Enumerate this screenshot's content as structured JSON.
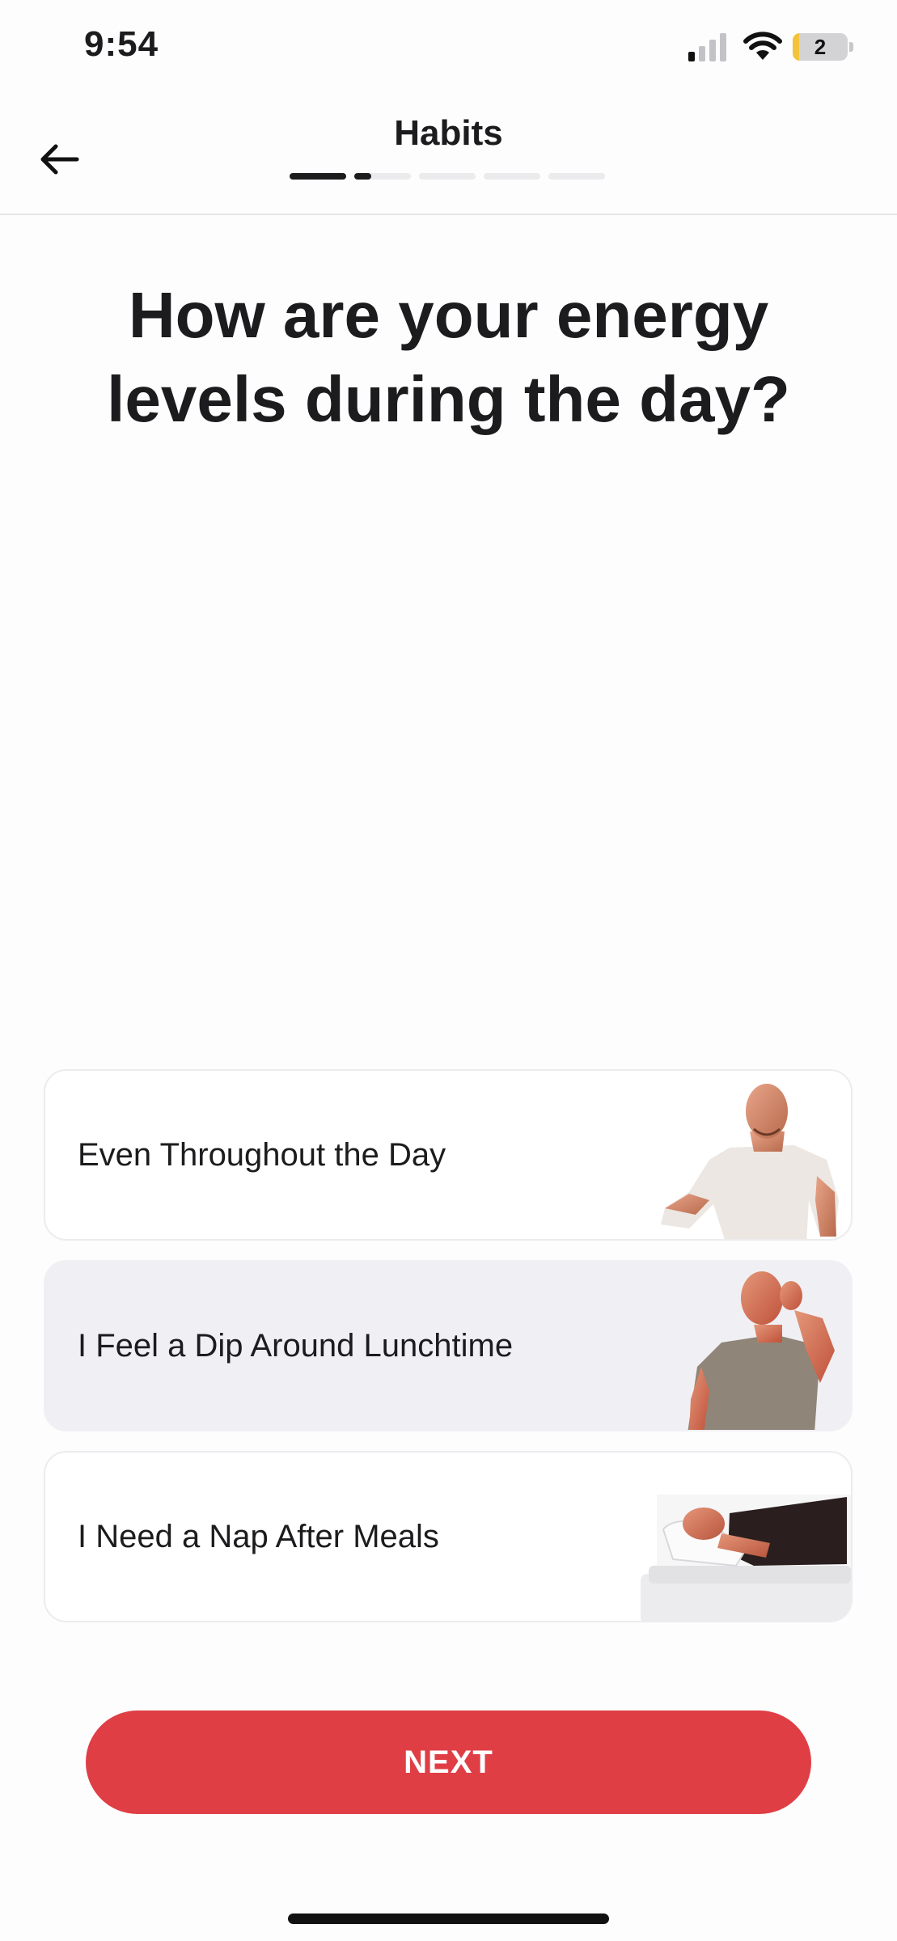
{
  "status_bar": {
    "time": "9:54",
    "battery_level": "2",
    "battery_fill_fraction": 0.12,
    "signal_bars_active": 1,
    "icons": [
      "cellular-signal-icon",
      "wifi-icon",
      "battery-icon"
    ]
  },
  "header": {
    "title": "Habits",
    "back_icon": "arrow-left-icon",
    "progress": {
      "steps_total": 5,
      "current_step": 2,
      "current_step_fraction": 0.3
    }
  },
  "question": "How are your energy levels during the day?",
  "options": [
    {
      "label": "Even Throughout the Day",
      "selected": false,
      "image": "energetic-man-figure"
    },
    {
      "label": "I Feel a Dip Around Lunchtime",
      "selected": true,
      "image": "tired-man-figure"
    },
    {
      "label": "I Need a Nap After Meals",
      "selected": false,
      "image": "sleeping-man-figure"
    }
  ],
  "next_button": {
    "label": "NEXT"
  },
  "colors": {
    "accent": "#e03e45",
    "text": "#1c1c1e",
    "selected_option_bg": "#f0f0f4",
    "progress_track": "#ebebee",
    "battery_fill": "#f3c33b"
  }
}
